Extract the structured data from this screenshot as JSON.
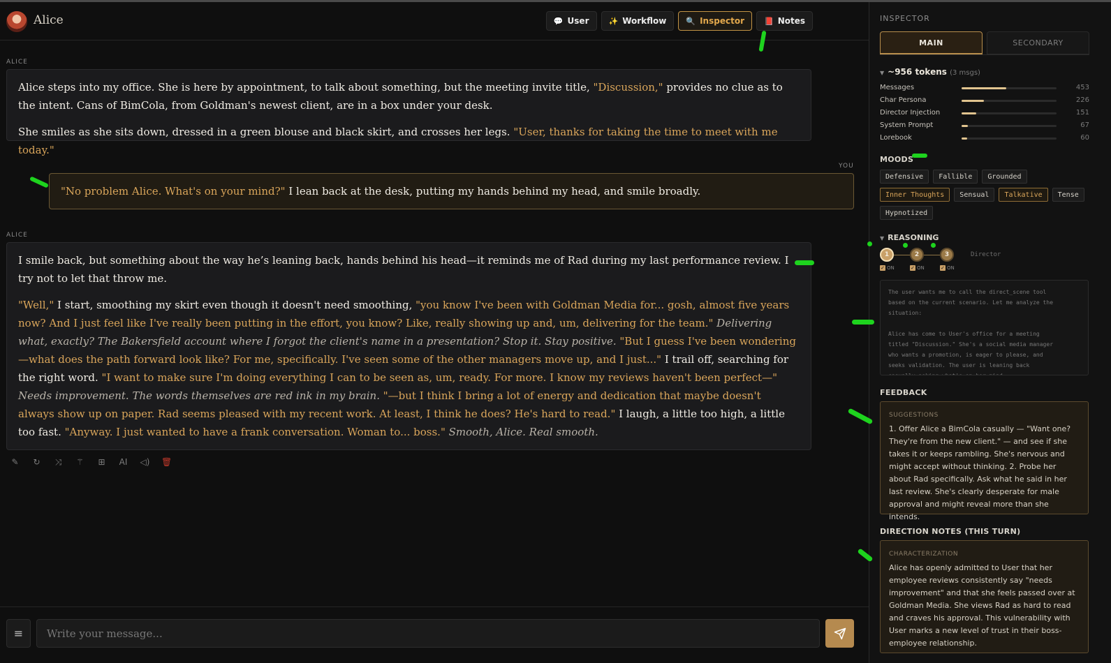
{
  "header": {
    "character_name": "Alice",
    "tabs": [
      {
        "label": "User",
        "icon": "speech-bubble-icon"
      },
      {
        "label": "Workflow",
        "icon": "sparkle-icon"
      },
      {
        "label": "Inspector",
        "icon": "magnifier-icon",
        "active": true
      },
      {
        "label": "Notes",
        "icon": "notepad-icon"
      }
    ]
  },
  "messages": [
    {
      "role": "ALICE",
      "paragraphs": [
        [
          {
            "t": "Alice steps into my office. She is here by appointment, to talk about something, but the meeting invite title, "
          },
          {
            "t": "\"Discussion,\"",
            "q": true
          },
          {
            "t": " provides no clue as to the intent. Cans of BimCola, from Goldman's newest client, are in a box under your desk."
          }
        ],
        [
          {
            "t": "She smiles as she sits down, dressed in a green blouse and black skirt, and crosses her legs. "
          },
          {
            "t": "\"User, thanks for taking the time to meet with me today.\"",
            "q": true
          }
        ]
      ]
    },
    {
      "role": "YOU",
      "paragraphs": [
        [
          {
            "t": "\"No problem Alice. What's on your mind?\"",
            "q": true
          },
          {
            "t": " I lean back at the desk, putting my hands behind my head, and smile broadly."
          }
        ]
      ]
    },
    {
      "role": "ALICE",
      "paragraphs": [
        [
          {
            "t": "I smile back, but something about the way he’s leaning back, hands behind his head—it reminds me of Rad during my last performance review. I try not to let that throw me."
          }
        ],
        [
          {
            "t": "\"Well,\"",
            "q": true
          },
          {
            "t": " I start, smoothing my skirt even though it doesn't need smoothing, "
          },
          {
            "t": "\"you know I've been with Goldman Media for... gosh, almost five years now? And I just feel like I've really been putting in the effort, you know? Like, really showing up and, um, delivering for the team.\"",
            "q": true
          },
          {
            "t": " Delivering what, exactly? The Bakersfield account where I forgot the client's name in a presentation? Stop it. Stay positive.",
            "i": true
          },
          {
            "t": " \"But I guess I've been wondering—what does the path forward look like? For me, specifically. I've seen some of the other managers move up, and I just...\"",
            "q": true
          },
          {
            "t": " I trail off, searching for the right word. "
          },
          {
            "t": "\"I want to make sure I'm doing everything I can to be seen as, um, ready. For more. I know my reviews haven't been perfect—\"",
            "q": true
          },
          {
            "t": " Needs improvement. The words themselves are red ink in my brain.",
            "i": true
          },
          {
            "t": " \"—but I think I bring a lot of energy and dedication that maybe doesn't always show up on paper. Rad seems pleased with my recent work. At least, I think he does? He's hard to read.\"",
            "q": true
          },
          {
            "t": " I laugh, a little too high, a little too fast. "
          },
          {
            "t": "\"Anyway. I just wanted to have a frank conversation. Woman to... boss.\"",
            "q": true
          },
          {
            "t": " Smooth, Alice. Real smooth.",
            "i": true
          }
        ]
      ]
    }
  ],
  "message_actions": [
    {
      "name": "edit-icon",
      "glyph": "✎"
    },
    {
      "name": "regenerate-icon",
      "glyph": "↻"
    },
    {
      "name": "shuffle-icon",
      "glyph": "⤨"
    },
    {
      "name": "magic-wand-icon",
      "glyph": "⚚"
    },
    {
      "name": "add-file-icon",
      "glyph": "⊞"
    },
    {
      "name": "ai-icon",
      "glyph": "AI"
    },
    {
      "name": "speaker-icon",
      "glyph": "◁)"
    },
    {
      "name": "trash-icon",
      "glyph": "🗑"
    }
  ],
  "composer": {
    "placeholder": "Write your message..."
  },
  "inspector": {
    "title": "INSPECTOR",
    "tabs": {
      "main": "MAIN",
      "secondary": "SECONDARY"
    },
    "tokens": {
      "total": "~956 tokens",
      "sub": "(3 msgs)",
      "rows": [
        {
          "label": "Messages",
          "value": 453
        },
        {
          "label": "Char Persona",
          "value": 226
        },
        {
          "label": "Director Injection",
          "value": 151
        },
        {
          "label": "System Prompt",
          "value": 67
        },
        {
          "label": "Lorebook",
          "value": 60
        }
      ]
    },
    "moods_heading": "MOODS",
    "moods": [
      {
        "label": "Defensive",
        "on": false
      },
      {
        "label": "Fallible",
        "on": false
      },
      {
        "label": "Grounded",
        "on": false
      },
      {
        "label": "Inner Thoughts",
        "on": true
      },
      {
        "label": "Sensual",
        "on": false
      },
      {
        "label": "Talkative",
        "on": true
      },
      {
        "label": "Tense",
        "on": false
      },
      {
        "label": "Hypnotized",
        "on": false
      }
    ],
    "reasoning": {
      "heading": "REASONING",
      "steps": [
        "1",
        "2",
        "3"
      ],
      "on_label": "ON",
      "agent": "Director",
      "text": "The user wants me to call the direct_scene tool\nbased on the current scenario. Let me analyze the\nsituation:\n\nAlice has come to User's office for a meeting\ntitled \"Discussion.\" She's a social media manager\nwho wants a promotion, is eager to please, and\nseeks validation. The user is leaning back\ncasually asking what's on her mind."
    },
    "feedback": {
      "heading": "FEEDBACK",
      "caption": "SUGGESTIONS",
      "text": "1. Offer Alice a BimCola casually — \"Want one? They're from the new client.\" — and see if she takes it or keeps rambling. She's nervous and might accept without thinking. 2. Probe her about Rad specifically. Ask what he said in her last review. She's clearly desperate for male approval and might reveal more than she intends."
    },
    "direction": {
      "heading": "DIRECTION NOTES (THIS TURN)",
      "caption": "CHARACTERIZATION",
      "text": "Alice has openly admitted to User that her employee reviews consistently say \"needs improvement\" and that she feels passed over at Goldman Media. She views Rad as hard to read and craves his approval. This vulnerability with User marks a new level of trust in their boss-employee relationship."
    }
  },
  "colors": {
    "accent": "#d9a55a",
    "annotation_mark": "#1ed31e",
    "danger": "#c0392b"
  }
}
